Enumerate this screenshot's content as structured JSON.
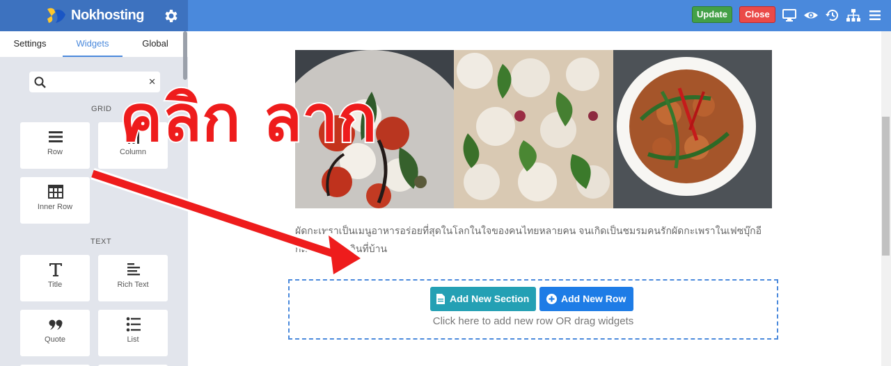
{
  "header": {
    "brand": "Nokhosting",
    "update_label": "Update",
    "close_label": "Close",
    "icons": [
      "settings-gear-icon",
      "desktop-preview-icon",
      "eye-preview-icon",
      "history-icon",
      "sitemap-icon",
      "menu-icon"
    ]
  },
  "sidebar": {
    "tabs": [
      {
        "label": "Settings"
      },
      {
        "label": "Widgets"
      },
      {
        "label": "Global"
      }
    ],
    "active_tab": "Widgets",
    "search": {
      "value": "",
      "placeholder": ""
    },
    "sections": {
      "grid": "GRID",
      "text": "TEXT"
    },
    "widgets": [
      {
        "label": "Row",
        "icon": "rows-icon"
      },
      {
        "label": "Column",
        "icon": "column-icon"
      },
      {
        "label": "Inner Row",
        "icon": "table-icon"
      },
      {
        "label": "Title",
        "icon": "title-t-icon"
      },
      {
        "label": "Rich Text",
        "icon": "align-left-icon"
      },
      {
        "label": "Quote",
        "icon": "quote-icon"
      },
      {
        "label": "List",
        "icon": "list-icon"
      }
    ]
  },
  "content": {
    "images": [
      "caprese-salad",
      "mushroom-pizza",
      "thai-basil-stir-fry"
    ],
    "caption": "ผัดกะเพราเป็นเมนูอาหารอร่อยที่สุดในโลกในใจของคนไทยหลายคน จนเกิดเป็นชมรมคนรักผัดกะเพราในเฟซบุ๊กอีกด้วย ลองทำกินที่บ้าน",
    "add_section_label": "Add New Section",
    "add_row_label": "Add New Row",
    "drop_hint": "Click here to add new row OR drag widgets"
  },
  "annotation": {
    "text": "คลิก ลาก",
    "color": "#ee1c1c"
  },
  "colors": {
    "topbar": "#4a89dc",
    "brand_bg": "#3d72bf",
    "update": "#43a047",
    "close": "#ea4a48",
    "add_section": "#24a0b4",
    "add_row": "#1e7ce6"
  }
}
